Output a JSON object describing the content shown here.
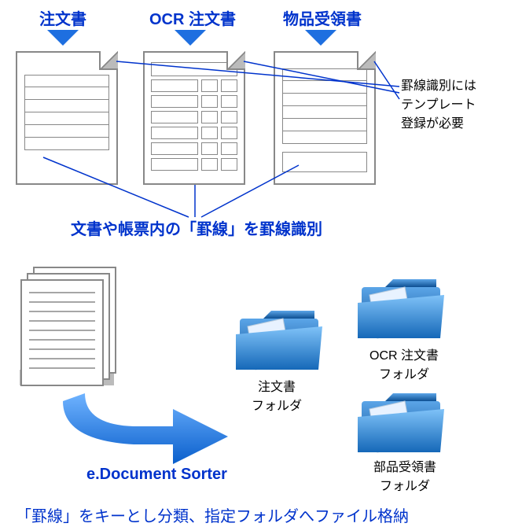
{
  "top_labels": {
    "doc1": "注文書",
    "doc2": "OCR 注文書",
    "doc3": "物品受領書"
  },
  "side_note": {
    "line1": "罫線識別には",
    "line2": "テンプレート",
    "line3": "登録が必要"
  },
  "mid_caption": "文書や帳票内の「罫線」を罫線識別",
  "app_name": "e.Document Sorter",
  "folders": {
    "f1": "注文書\nフォルダ",
    "f2": "OCR 注文書\nフォルダ",
    "f3": "部品受領書\nフォルダ"
  },
  "bottom_caption": "「罫線」をキーとし分類、指定フォルダへファイル格納",
  "colors": {
    "blue": "#0033cc",
    "arrow_blue": "#1e6fe0",
    "folder_blue": "#2a7fd4",
    "gray": "#888"
  }
}
